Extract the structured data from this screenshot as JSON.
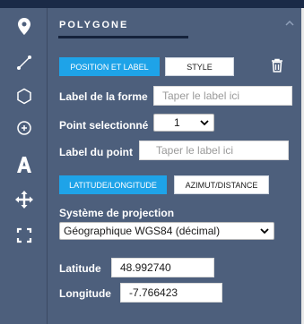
{
  "toolbar": {
    "tools": [
      {
        "name": "marker-icon"
      },
      {
        "name": "line-icon"
      },
      {
        "name": "polygon-icon"
      },
      {
        "name": "circle-icon"
      },
      {
        "name": "text-icon"
      },
      {
        "name": "move-icon"
      },
      {
        "name": "fullscreen-icon"
      }
    ]
  },
  "panel": {
    "title": "POLYGONE",
    "tabs": {
      "position_label": "POSITION ET LABEL",
      "style": "STYLE"
    },
    "form": {
      "shape_label": {
        "label": "Label de la forme",
        "placeholder": "Taper le label ici"
      },
      "selected_point": {
        "label": "Point selectionné",
        "value": "1"
      },
      "point_label": {
        "label": "Label du point",
        "placeholder": "Taper le label ici"
      }
    },
    "coord_tabs": {
      "latlon": "LATITUDE/LONGITUDE",
      "azimuth": "AZIMUT/DISTANCE"
    },
    "projection": {
      "label": "Système de projection",
      "value": "Géographique WGS84 (décimal)"
    },
    "latitude": {
      "label": "Latitude",
      "value": "48.992740"
    },
    "longitude": {
      "label": "Longitude",
      "value": "-7.766423"
    }
  },
  "colors": {
    "accent": "#1ea3e8",
    "panel_bg": "#4d5f7c",
    "dark": "#15223b"
  }
}
